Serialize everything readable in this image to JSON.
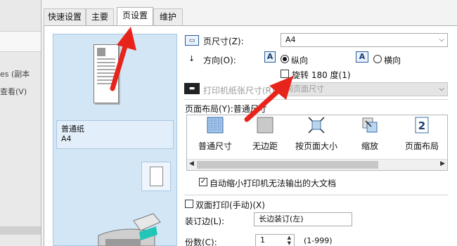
{
  "background": {
    "line1": "es (副本",
    "line2": "查看(V)"
  },
  "tabs": [
    {
      "label": "快速设置"
    },
    {
      "label": "主要"
    },
    {
      "label": "页设置"
    },
    {
      "label": "维护"
    }
  ],
  "preview": {
    "paper_type": "普通纸",
    "paper_size": "A4"
  },
  "page_size": {
    "label": "页尺寸(Z):",
    "value": "A4"
  },
  "orientation": {
    "label": "方向(O):",
    "portrait": "纵向",
    "landscape": "横向",
    "selected": "portrait"
  },
  "rotate": {
    "label": "旋转 180 度(1)",
    "checked": false
  },
  "printer_paper_size": {
    "label": "打印机纸张尺寸(R)",
    "value": "同页面尺寸"
  },
  "page_layout": {
    "label": "页面布局(Y):普通尺寸",
    "items": [
      {
        "label": "普通尺寸"
      },
      {
        "label": "无边距"
      },
      {
        "label": "按页面大小"
      },
      {
        "label": "缩放"
      },
      {
        "label": "页面布局"
      }
    ]
  },
  "auto_shrink": {
    "label": "自动缩小打印机无法输出的大文档",
    "checked": true
  },
  "duplex": {
    "label": "双面打印(手动)(X)",
    "checked": false
  },
  "binding": {
    "label": "装订边(L):",
    "value": "长边装订(左)"
  },
  "copies": {
    "label": "份数(C):",
    "value": "1",
    "range": "(1-999)"
  },
  "colors": {
    "accent": "#2a5d9a",
    "preview_bg": "#d3e6f6",
    "arrow": "#e8231c"
  }
}
